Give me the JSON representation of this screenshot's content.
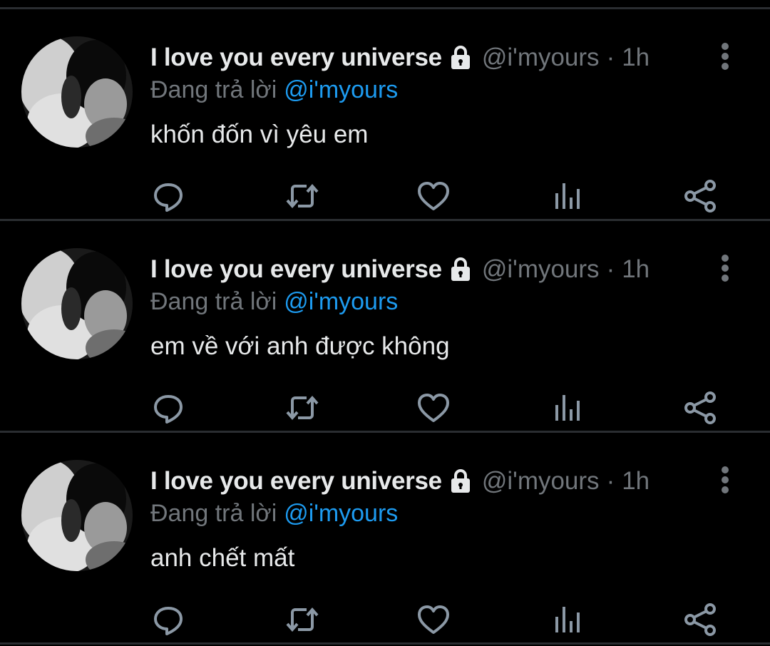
{
  "tweets": [
    {
      "display_name": "I love you every universe",
      "handle": "@i'myours",
      "separator": "·",
      "time": "1h",
      "reply_prefix": "Đang trả lời",
      "reply_to": "@i'myours",
      "text": "khốn đốn vì yêu em"
    },
    {
      "display_name": "I love you every universe",
      "handle": "@i'myours",
      "separator": "·",
      "time": "1h",
      "reply_prefix": "Đang trả lời",
      "reply_to": "@i'myours",
      "text": "em về với anh được không"
    },
    {
      "display_name": "I love you every universe",
      "handle": "@i'myours",
      "separator": "·",
      "time": "1h",
      "reply_prefix": "Đang trả lời",
      "reply_to": "@i'myours",
      "text": "anh chết mất"
    }
  ],
  "icons": {
    "lock": "lock-icon",
    "more": "more-vertical-icon",
    "reply": "reply-icon",
    "retweet": "retweet-icon",
    "like": "heart-icon",
    "views": "analytics-icon",
    "share": "share-icon"
  },
  "colors": {
    "background": "#000000",
    "text_primary": "#e7e9ea",
    "text_secondary": "#71767b",
    "mention": "#1d9bf0",
    "divider": "#2a2d31"
  }
}
